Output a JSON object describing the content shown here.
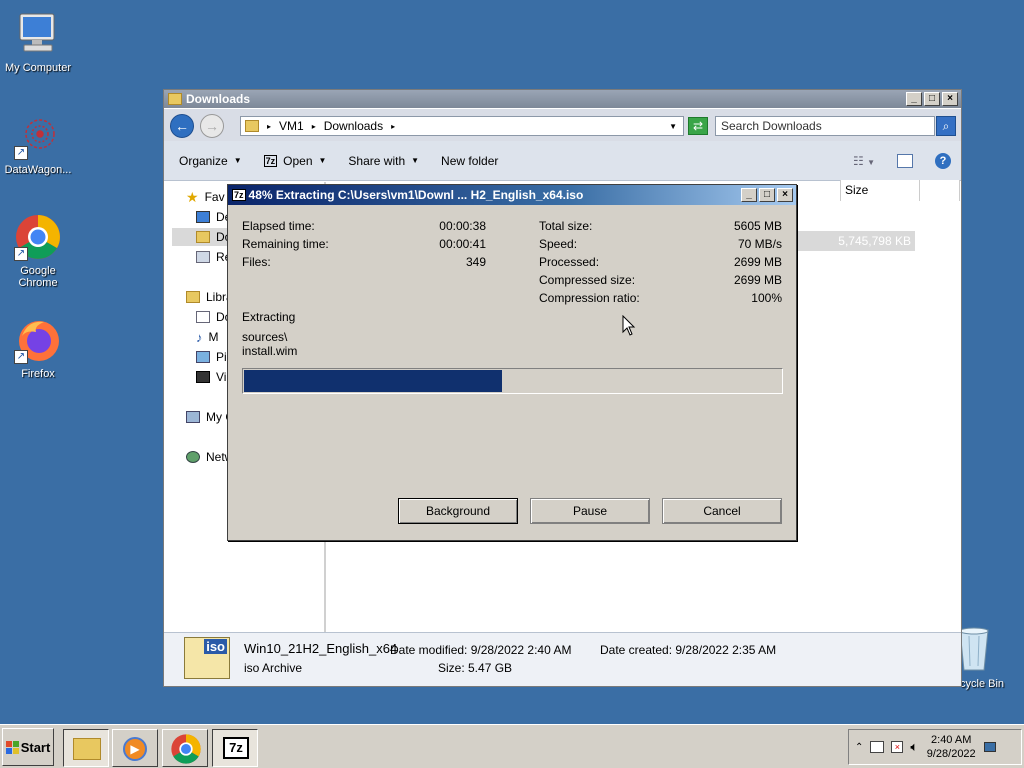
{
  "desktop": {
    "icons": [
      {
        "label": "My Computer"
      },
      {
        "label": "DataWagon..."
      },
      {
        "label": "Google Chrome"
      },
      {
        "label": "Firefox"
      },
      {
        "label": "cycle Bin"
      }
    ]
  },
  "explorer": {
    "title": "Downloads",
    "breadcrumb": [
      "VM1",
      "Downloads"
    ],
    "search_placeholder": "Search Downloads",
    "toolbar": {
      "organize": "Organize",
      "open": "Open",
      "share_with": "Share with",
      "new_folder": "New folder"
    },
    "nav": {
      "favorites": "Fav",
      "fav_items": [
        "De",
        "Do",
        "Re"
      ],
      "libraries": "Libra",
      "lib_items": [
        "Do",
        "M",
        "Pi",
        "Vi"
      ],
      "my_computer": "My C",
      "network": "Netw"
    },
    "columns": {
      "size": "Size"
    },
    "selected_size": "5,745,798 KB",
    "details": {
      "filename": "Win10_21H2_English_x64",
      "filetype": "iso Archive",
      "date_modified": "Date modified: 9/28/2022 2:40 AM",
      "size": "Size: 5.47 GB",
      "date_created": "Date created: 9/28/2022 2:35 AM",
      "icon_label": "iso"
    }
  },
  "dialog": {
    "app_icon": "7z",
    "title": "48% Extracting C:\\Users\\vm1\\Downl ... H2_English_x64.iso",
    "left": [
      {
        "label": "Elapsed time:",
        "value": "00:00:38"
      },
      {
        "label": "Remaining time:",
        "value": "00:00:41"
      },
      {
        "label": "Files:",
        "value": "349"
      }
    ],
    "right": [
      {
        "label": "Total size:",
        "value": "5605 MB"
      },
      {
        "label": "Speed:",
        "value": "70 MB/s"
      },
      {
        "label": "Processed:",
        "value": "2699 MB"
      },
      {
        "label": "Compressed size:",
        "value": "2699 MB"
      },
      {
        "label": "Compression ratio:",
        "value": "100%"
      }
    ],
    "status": "Extracting",
    "path_line1": "sources\\",
    "path_line2": "install.wim",
    "progress": 0.48,
    "buttons": {
      "background": "Background",
      "pause": "Pause",
      "cancel": "Cancel"
    }
  },
  "taskbar": {
    "start": "Start",
    "app_7z": "7z",
    "time": "2:40 AM",
    "date": "9/28/2022"
  },
  "colors": {
    "desktop": "#3a6ea5",
    "progress": "#10306e",
    "title_active": "#0a246a"
  }
}
